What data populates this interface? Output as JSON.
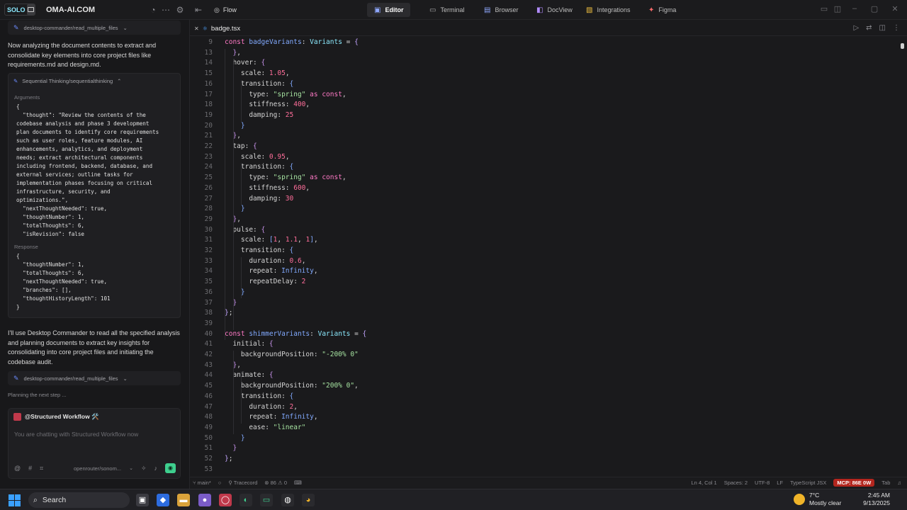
{
  "topbar": {
    "brand": "OMA-AI.COM",
    "logo_text": "SOLO",
    "flow": "Flow",
    "tabs": [
      {
        "label": "Editor",
        "icon": "editor-icon"
      },
      {
        "label": "Terminal",
        "icon": "terminal-icon"
      },
      {
        "label": "Browser",
        "icon": "browser-icon"
      },
      {
        "label": "DocView",
        "icon": "docview-icon"
      },
      {
        "label": "Integrations",
        "icon": "integrations-icon"
      },
      {
        "label": "Figma",
        "icon": "figma-icon"
      }
    ]
  },
  "left": {
    "tool1": "desktop-commander/read_multiple_files",
    "msg1": "Now analyzing the document contents to extract and consolidate key elements into core project files like requirements.md and design.md.",
    "card": {
      "title": "Sequential Thinking/sequentialthinking",
      "args_label": "Arguments",
      "response_label": "Response",
      "args": "{\n  \"thought\": \"Review the contents of the\ncodebase analysis and phase 3 development\nplan documents to identify core requirements\nsuch as user roles, feature modules, AI\nenhancements, analytics, and deployment\nneeds; extract architectural components\nincluding frontend, backend, database, and\nexternal services; outline tasks for\nimplementation phases focusing on critical\ninfrastructure, security, and\noptimizations.\",\n  \"nextThoughtNeeded\": true,\n  \"thoughtNumber\": 1,\n  \"totalThoughts\": 6,\n  \"isRevision\": false",
      "response": "{\n  \"thoughtNumber\": 1,\n  \"totalThoughts\": 6,\n  \"nextThoughtNeeded\": true,\n  \"branches\": [],\n  \"thoughtHistoryLength\": 101\n}"
    },
    "msg2": "I'll use Desktop Commander to read all the specified analysis and planning documents to extract key insights for consolidating into core project files and initiating the codebase audit.",
    "tool2": "desktop-commander/read_multiple_files",
    "planning": "Planning the next step ...",
    "chat": {
      "title": "@Structured Workflow 🛠️",
      "placeholder": "You are chatting with Structured Workflow now",
      "model": "openrouter/sonom..."
    }
  },
  "editor": {
    "filename": "badge.tsx",
    "lines": [
      {
        "n": "9",
        "h": "<span class='k'>const</span> <span class='c'>badgeVariants</span>: <span class='t'>Variants</span> = <span class='b'>{</span>"
      },
      {
        "n": "13",
        "h": "  <span class='p'>}</span>,"
      },
      {
        "n": "14",
        "h": "  hover: <span class='p'>{</span>"
      },
      {
        "n": "15",
        "h": "    scale: <span class='n'>1.05</span>,"
      },
      {
        "n": "16",
        "h": "    transition: <span class='c'>{</span>"
      },
      {
        "n": "17",
        "h": "      type: <span class='s'>\"spring\"</span> <span class='k'>as</span> <span class='k'>const</span>,"
      },
      {
        "n": "18",
        "h": "      stiffness: <span class='n'>400</span>,"
      },
      {
        "n": "19",
        "h": "      damping: <span class='n'>25</span>"
      },
      {
        "n": "20",
        "h": "    <span class='c'>}</span>"
      },
      {
        "n": "21",
        "h": "  <span class='p'>}</span>,"
      },
      {
        "n": "22",
        "h": "  tap: <span class='p'>{</span>"
      },
      {
        "n": "23",
        "h": "    scale: <span class='n'>0.95</span>,"
      },
      {
        "n": "24",
        "h": "    transition: <span class='c'>{</span>"
      },
      {
        "n": "25",
        "h": "      type: <span class='s'>\"spring\"</span> <span class='k'>as</span> <span class='k'>const</span>,"
      },
      {
        "n": "26",
        "h": "      stiffness: <span class='n'>600</span>,"
      },
      {
        "n": "27",
        "h": "      damping: <span class='n'>30</span>"
      },
      {
        "n": "28",
        "h": "    <span class='c'>}</span>"
      },
      {
        "n": "29",
        "h": "  <span class='p'>}</span>,"
      },
      {
        "n": "30",
        "h": "  pulse: <span class='p'>{</span>"
      },
      {
        "n": "31",
        "h": "    scale: <span class='c'>[</span><span class='n'>1</span>, <span class='n'>1.1</span>, <span class='n'>1</span><span class='c'>]</span>,"
      },
      {
        "n": "32",
        "h": "    transition: <span class='c'>{</span>"
      },
      {
        "n": "33",
        "h": "      duration: <span class='n'>0.6</span>,"
      },
      {
        "n": "34",
        "h": "      repeat: <span class='c'>Infinity</span>,"
      },
      {
        "n": "35",
        "h": "      repeatDelay: <span class='n'>2</span>"
      },
      {
        "n": "36",
        "h": "    <span class='c'>}</span>"
      },
      {
        "n": "37",
        "h": "  <span class='p'>}</span>"
      },
      {
        "n": "38",
        "h": "<span class='b'>}</span>;"
      },
      {
        "n": "39",
        "h": ""
      },
      {
        "n": "40",
        "h": "<span class='k'>const</span> <span class='c'>shimmerVariants</span>: <span class='t'>Variants</span> = <span class='b'>{</span>"
      },
      {
        "n": "41",
        "h": "  initial: <span class='p'>{</span>"
      },
      {
        "n": "42",
        "h": "    backgroundPosition: <span class='s'>\"-200% 0\"</span>"
      },
      {
        "n": "43",
        "h": "  <span class='p'>}</span>,"
      },
      {
        "n": "44",
        "h": "  animate: <span class='p'>{</span>"
      },
      {
        "n": "45",
        "h": "    backgroundPosition: <span class='s'>\"200% 0\"</span>,"
      },
      {
        "n": "46",
        "h": "    transition: <span class='c'>{</span>"
      },
      {
        "n": "47",
        "h": "      duration: <span class='n'>2</span>,"
      },
      {
        "n": "48",
        "h": "      repeat: <span class='c'>Infinity</span>,"
      },
      {
        "n": "49",
        "h": "      ease: <span class='s'>\"linear\"</span>"
      },
      {
        "n": "50",
        "h": "    <span class='c'>}</span>"
      },
      {
        "n": "51",
        "h": "  <span class='p'>}</span>"
      },
      {
        "n": "52",
        "h": "<span class='b'>}</span>;"
      },
      {
        "n": "53",
        "h": ""
      }
    ]
  },
  "status": {
    "branch": "main*",
    "trace": "Tracecord",
    "errors": "86",
    "warnings": "0",
    "pos": "Ln 4, Col 1",
    "spaces": "Spaces: 2",
    "enc": "UTF-8",
    "eol": "LF",
    "lang": "TypeScript JSX",
    "mcp": "MCP: 86E 0W",
    "tab": "Tab"
  },
  "taskbar": {
    "search": "Search",
    "temp": "7°C",
    "weather": "Mostly clear",
    "time": "2:45 AM",
    "date": "9/13/2025"
  }
}
